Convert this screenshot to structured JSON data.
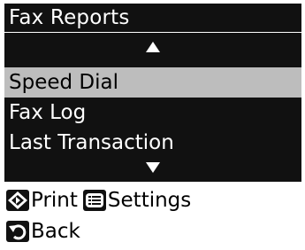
{
  "screen": {
    "title": "Fax Reports"
  },
  "menu": {
    "scroll_up_icon": "triangle-up-icon",
    "scroll_down_icon": "triangle-down-icon",
    "items": [
      {
        "label": "Speed Dial",
        "selected": true
      },
      {
        "label": "Fax Log",
        "selected": false
      },
      {
        "label": "Last Transaction",
        "selected": false
      }
    ]
  },
  "softkeys": {
    "start": {
      "icon": "start-diamond-icon",
      "label": "Print"
    },
    "menu": {
      "icon": "menu-list-icon",
      "label": "Settings"
    },
    "back": {
      "icon": "back-arrow-icon",
      "label": "Back"
    }
  },
  "colors": {
    "background": "#111111",
    "foreground": "#ffffff",
    "highlight": "#bdbdbd"
  }
}
